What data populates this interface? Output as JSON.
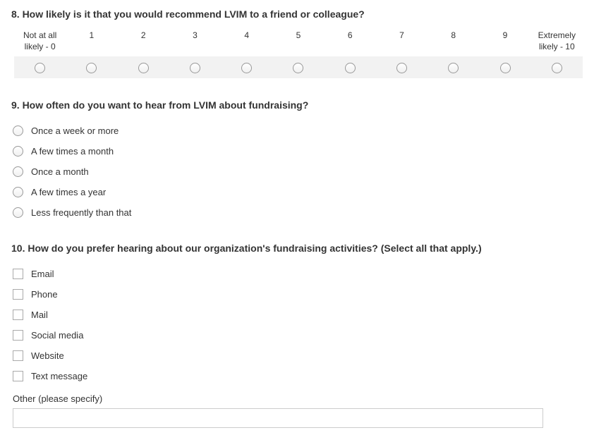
{
  "q8": {
    "title": "8. How likely is it that you would recommend LVIM to a friend or colleague?",
    "scale": [
      "Not at all\nlikely - 0",
      "1",
      "2",
      "3",
      "4",
      "5",
      "6",
      "7",
      "8",
      "9",
      "Extremely\nlikely - 10"
    ]
  },
  "q9": {
    "title": "9. How often do you want to hear from LVIM about fundraising?",
    "options": [
      "Once a week or more",
      "A few times a month",
      "Once a month",
      "A few times a year",
      "Less frequently than that"
    ]
  },
  "q10": {
    "title": "10. How do you prefer hearing about our organization's fundraising activities? (Select all that apply.)",
    "options": [
      "Email",
      "Phone",
      "Mail",
      "Social media",
      "Website",
      "Text message"
    ],
    "other_label": "Other (please specify)",
    "other_value": ""
  }
}
